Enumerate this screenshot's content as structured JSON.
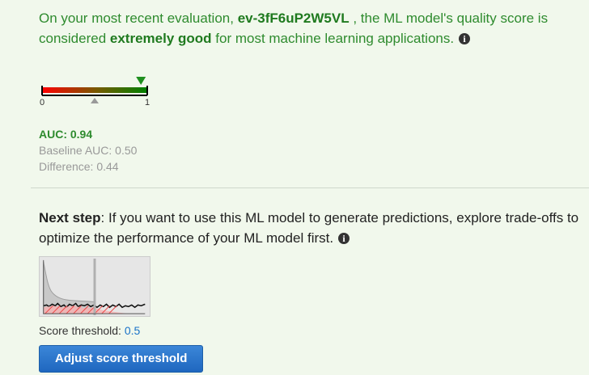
{
  "evaluation": {
    "text_before_id": "On your most recent evaluation, ",
    "evaluation_id": "ev-3fF6uP2W5VL",
    "text_after_id": " , the ML model's quality score is considered ",
    "quality_label": "extremely good",
    "text_after_quality": " for most machine learning applications.",
    "info_icon": "info-icon"
  },
  "gauge": {
    "min_label": "0",
    "max_label": "1",
    "model_auc": 0.94,
    "baseline_auc": 0.5,
    "low_color": "#ff0000",
    "high_color": "#008000",
    "model_marker_color": "#1f8f1f",
    "baseline_marker_color": "#9a9a9a"
  },
  "metrics": {
    "auc_label": "AUC: 0.94",
    "baseline_label": "Baseline AUC: 0.50",
    "difference_label": "Difference: 0.44"
  },
  "next_step": {
    "label": "Next step",
    "text": ": If you want to use this ML model to generate predictions, explore trade-offs to optimize the performance of your ML model first.",
    "info_icon": "info-icon",
    "score_threshold_label": "Score threshold: ",
    "score_threshold_value": "0.5",
    "adjust_button_label": "Adjust score threshold"
  },
  "colors": {
    "success_text": "#2e8b2e",
    "link": "#1a73c8",
    "button": "#1f67bf",
    "page_background": "#f1f8ec"
  }
}
